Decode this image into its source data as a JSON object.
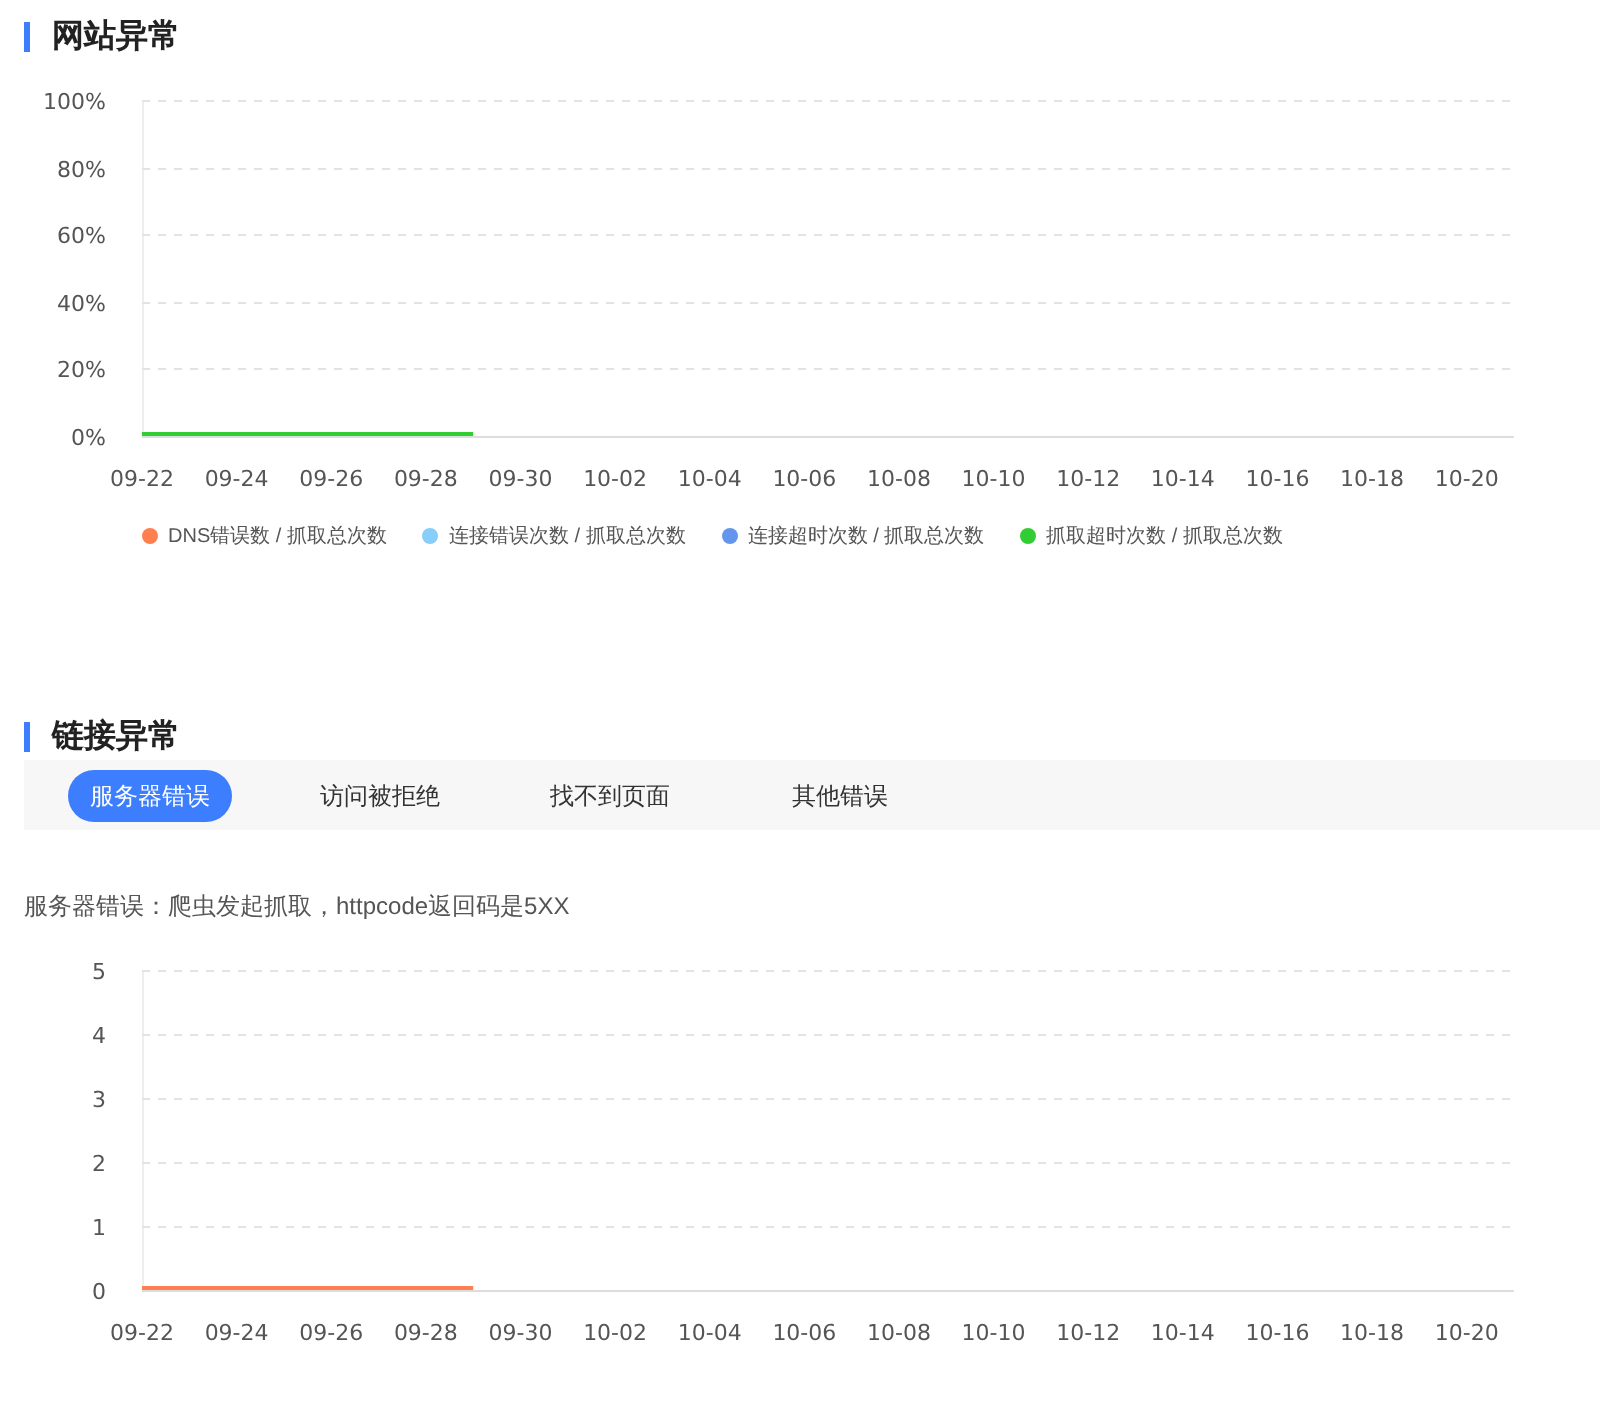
{
  "sections": [
    {
      "title": "网站异常",
      "chart_data": {
        "type": "line",
        "grid": true,
        "categories": [
          "09-22",
          null,
          "09-24",
          null,
          "09-26",
          null,
          "09-28",
          null,
          "09-30",
          null,
          "10-02",
          null,
          "10-04",
          null,
          "10-06",
          null,
          "10-08",
          null,
          "10-10",
          null,
          "10-12",
          null,
          "10-14",
          null,
          "10-16",
          null,
          "10-18",
          null,
          "10-20",
          null
        ],
        "ylim": [
          0,
          100
        ],
        "yticks": [
          {
            "value": 0,
            "label": "0%"
          },
          {
            "value": 20,
            "label": "20%"
          },
          {
            "value": 40,
            "label": "40%"
          },
          {
            "value": 60,
            "label": "60%"
          },
          {
            "value": 80,
            "label": "80%"
          },
          {
            "value": 100,
            "label": "100%"
          }
        ],
        "series": [
          {
            "name": "DNS错误数 / 抓取总次数",
            "color": "#ff7f50",
            "values": [
              null,
              null,
              null,
              null,
              null,
              null,
              null,
              null,
              null,
              null,
              null,
              null,
              null,
              null,
              null,
              null,
              null,
              null,
              null,
              null,
              null,
              null,
              null,
              null,
              null,
              null,
              null,
              null,
              null,
              null
            ]
          },
          {
            "name": "连接错误次数 / 抓取总次数",
            "color": "#87cefa",
            "values": [
              null,
              null,
              null,
              null,
              null,
              null,
              null,
              null,
              null,
              null,
              null,
              null,
              null,
              null,
              null,
              null,
              null,
              null,
              null,
              null,
              null,
              null,
              null,
              null,
              null,
              null,
              null,
              null,
              null,
              null
            ]
          },
          {
            "name": "连接超时次数 / 抓取总次数",
            "color": "#6495ed",
            "values": [
              null,
              null,
              null,
              null,
              null,
              null,
              null,
              null,
              null,
              null,
              null,
              null,
              null,
              null,
              null,
              null,
              null,
              null,
              null,
              null,
              null,
              null,
              null,
              null,
              null,
              null,
              null,
              null,
              null,
              null
            ]
          },
          {
            "name": "抓取超时次数 / 抓取总次数",
            "color": "#32cd32",
            "values": [
              0,
              0,
              0,
              0,
              0,
              0,
              0,
              0,
              null,
              null,
              null,
              null,
              null,
              null,
              null,
              null,
              null,
              null,
              null,
              null,
              null,
              null,
              null,
              null,
              null,
              null,
              null,
              null,
              null,
              null
            ]
          }
        ]
      }
    },
    {
      "title": "链接异常",
      "tabs": [
        {
          "label": "服务器错误",
          "selected": true
        },
        {
          "label": "访问被拒绝",
          "selected": false
        },
        {
          "label": "找不到页面",
          "selected": false
        },
        {
          "label": "其他错误",
          "selected": false
        }
      ],
      "description": "服务器错误：爬虫发起抓取，httpcode返回码是5XX",
      "chart_data": {
        "type": "line",
        "grid": true,
        "categories": [
          "09-22",
          null,
          "09-24",
          null,
          "09-26",
          null,
          "09-28",
          null,
          "09-30",
          null,
          "10-02",
          null,
          "10-04",
          null,
          "10-06",
          null,
          "10-08",
          null,
          "10-10",
          null,
          "10-12",
          null,
          "10-14",
          null,
          "10-16",
          null,
          "10-18",
          null,
          "10-20",
          null
        ],
        "ylim": [
          0,
          5
        ],
        "yticks": [
          0,
          1,
          2,
          3,
          4,
          5
        ],
        "series": [
          {
            "color": "#ff7f50",
            "values": [
              0,
              0,
              0,
              0,
              0,
              0,
              0,
              0,
              null,
              null,
              null,
              null,
              null,
              null,
              null,
              null,
              null,
              null,
              null,
              null,
              null,
              null,
              null,
              null,
              null,
              null,
              null,
              null,
              null,
              null
            ]
          }
        ]
      }
    }
  ]
}
